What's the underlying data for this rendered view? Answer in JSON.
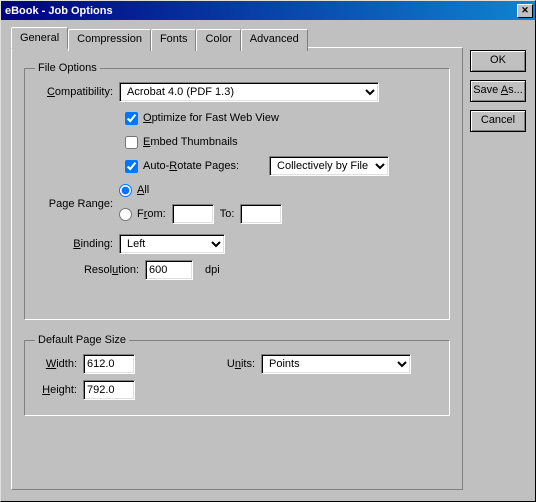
{
  "window": {
    "title": "eBook - Job Options"
  },
  "tabs": {
    "general": "General",
    "compression": "Compression",
    "fonts": "Fonts",
    "color": "Color",
    "advanced": "Advanced"
  },
  "buttons": {
    "ok": "OK",
    "saveas": "Save As...",
    "cancel": "Cancel"
  },
  "group_file": {
    "legend": "File Options",
    "compat_label": "Compatibility:",
    "compat_value": "Acrobat 4.0 (PDF 1.3)",
    "optimize": "Optimize for Fast Web View",
    "embed": "Embed Thumbnails",
    "autorotate": "Auto-Rotate Pages:",
    "autorotate_mode": "Collectively by File",
    "page_range": "Page Range:",
    "all": "All",
    "from": "From:",
    "to": "To:",
    "from_val": "",
    "to_val": "",
    "binding_label": "Binding:",
    "binding_value": "Left",
    "resolution_label": "Resolution:",
    "resolution_value": "600",
    "dpi": "dpi"
  },
  "group_page": {
    "legend": "Default Page Size",
    "width_label": "Width:",
    "width_value": "612.0",
    "units_label": "Units:",
    "units_value": "Points",
    "height_label": "Height:",
    "height_value": "792.0"
  }
}
